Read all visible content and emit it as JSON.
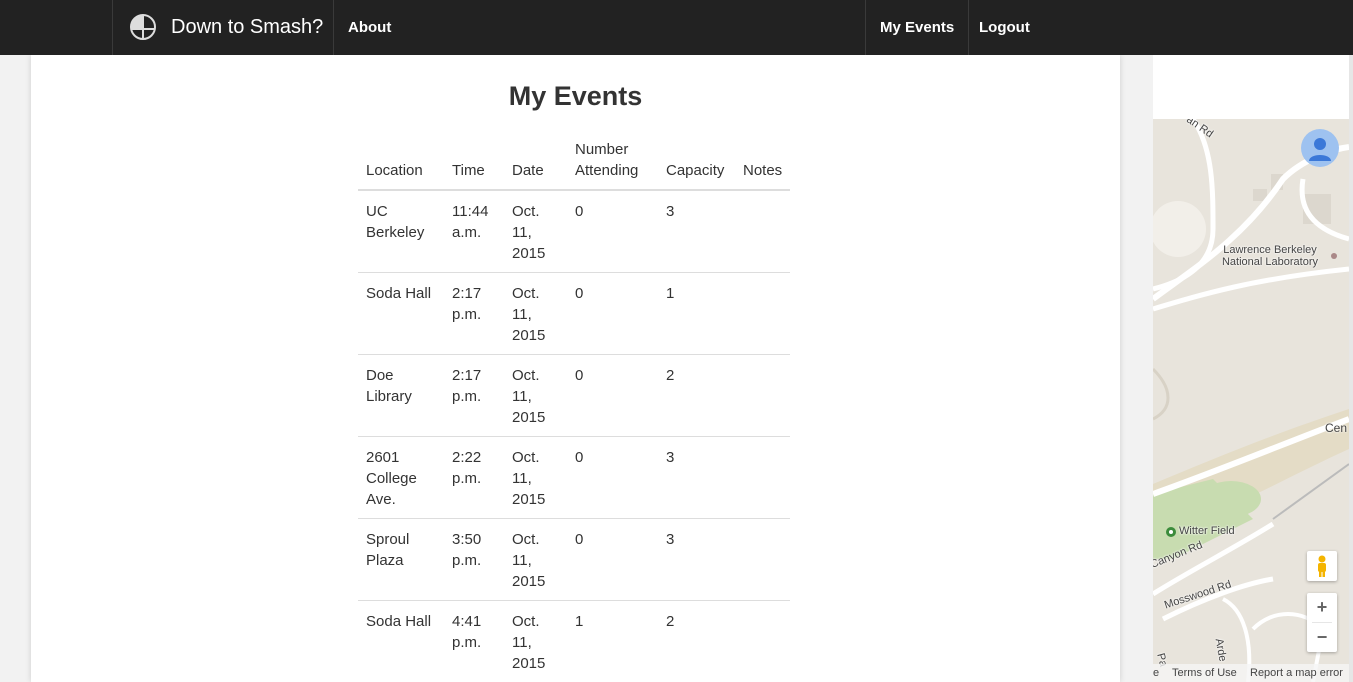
{
  "navbar": {
    "brand": "Down to Smash?",
    "about": "About",
    "my_events": "My Events",
    "logout": "Logout",
    "logo_icon": "smash-ball-icon"
  },
  "page": {
    "title": "My Events"
  },
  "table": {
    "headers": {
      "location": "Location",
      "time": "Time",
      "date": "Date",
      "number_attending": "Number Attending",
      "capacity": "Capacity",
      "notes": "Notes"
    },
    "rows": [
      {
        "location": "UC Berkeley",
        "time": "11:44 a.m.",
        "date": "Oct. 11, 2015",
        "attending": "0",
        "capacity": "3",
        "notes": ""
      },
      {
        "location": "Soda Hall",
        "time": "2:17 p.m.",
        "date": "Oct. 11, 2015",
        "attending": "0",
        "capacity": "1",
        "notes": ""
      },
      {
        "location": "Doe Library",
        "time": "2:17 p.m.",
        "date": "Oct. 11, 2015",
        "attending": "0",
        "capacity": "2",
        "notes": ""
      },
      {
        "location": "2601 College Ave.",
        "time": "2:22 p.m.",
        "date": "Oct. 11, 2015",
        "attending": "0",
        "capacity": "3",
        "notes": ""
      },
      {
        "location": "Sproul Plaza",
        "time": "3:50 p.m.",
        "date": "Oct. 11, 2015",
        "attending": "0",
        "capacity": "3",
        "notes": ""
      },
      {
        "location": "Soda Hall",
        "time": "4:41 p.m.",
        "date": "Oct. 11, 2015",
        "attending": "1",
        "capacity": "2",
        "notes": ""
      }
    ]
  },
  "map": {
    "labels": {
      "road_top": "an Rd",
      "lab": "Lawrence Berkeley National Laboratory",
      "cen": "Cen",
      "witter": "Witter Field",
      "canyon": "Canyon Rd",
      "mosswood": "Mosswood Rd",
      "arden": "Arde",
      "pa": "Pa"
    },
    "zoom_in": "+",
    "zoom_out": "−",
    "footer": {
      "e": "e",
      "terms": "Terms of Use",
      "report": "Report a map error"
    },
    "colors": {
      "land": "#e8e4dc",
      "park": "#c8dcb0",
      "road": "#ffffff"
    }
  }
}
